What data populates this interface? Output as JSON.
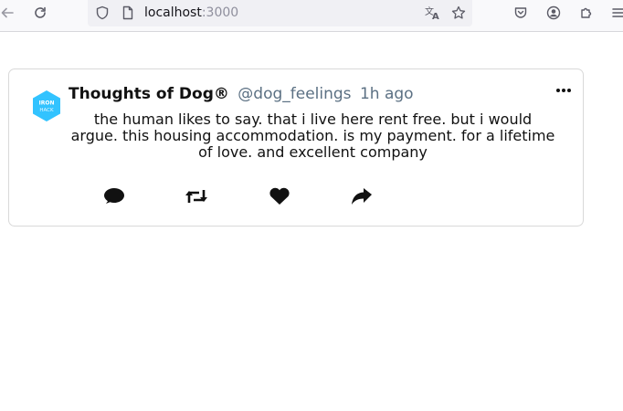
{
  "browser": {
    "url_host": "localhost",
    "url_port": ":3000"
  },
  "tweet": {
    "user_name": "Thoughts of Dog®",
    "user_handle": "@dog_feelings",
    "timestamp": "1h ago",
    "avatar_logo_text": "IRON HACK",
    "message": "the human likes to say. that i live here rent free. but i would argue. this housing accommodation. is my payment. for a lifetime of love. and excellent company",
    "actions": [
      "comment-icon",
      "retweet-icon",
      "heart-icon",
      "share-icon"
    ],
    "avatar_color": "#32c3ff"
  }
}
